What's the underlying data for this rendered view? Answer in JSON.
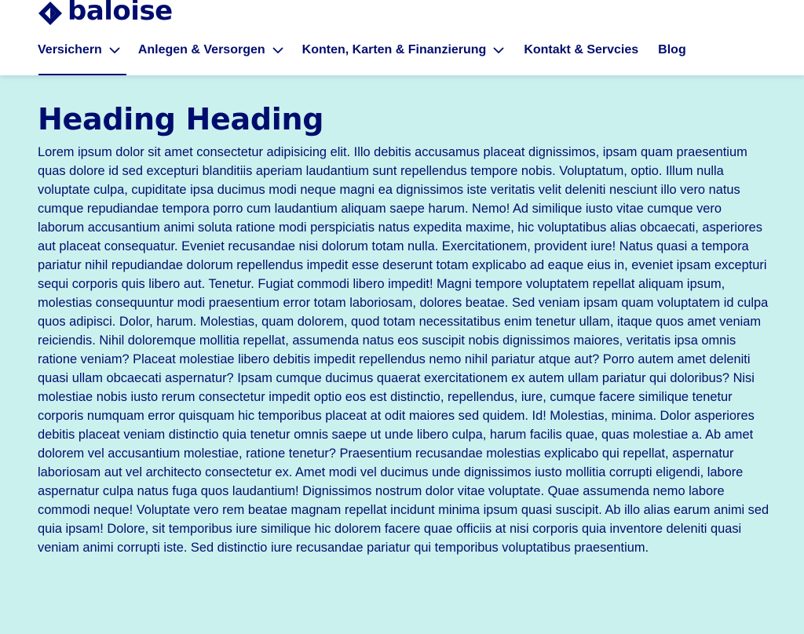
{
  "brand": {
    "name": "baloise",
    "logo_icon": "diamond-logo-icon",
    "color": "#000d6e"
  },
  "nav": {
    "items": [
      {
        "label": "Versichern",
        "has_dropdown": true,
        "active": true
      },
      {
        "label": "Anlegen & Versorgen",
        "has_dropdown": true,
        "active": false
      },
      {
        "label": "Konten, Karten & Finanzierung",
        "has_dropdown": true,
        "active": false
      },
      {
        "label": "Kontakt & Servcies",
        "has_dropdown": false,
        "active": false
      },
      {
        "label": "Blog",
        "has_dropdown": false,
        "active": false
      }
    ]
  },
  "main": {
    "heading": "Heading Heading",
    "paragraph": "Lorem ipsum dolor sit amet consectetur adipisicing elit. Illo debitis accusamus placeat dignissimos, ipsam quam praesentium quas dolore id sed excepturi blanditiis aperiam laudantium sunt repellendus tempore nobis. Voluptatum, optio. Illum nulla voluptate culpa, cupiditate ipsa ducimus modi neque magni ea dignissimos iste veritatis velit deleniti nesciunt illo vero natus cumque repudiandae tempora porro cum laudantium aliquam saepe harum. Nemo! Ad similique iusto vitae cumque vero laborum accusantium animi soluta ratione modi perspiciatis natus expedita maxime, hic voluptatibus alias obcaecati, asperiores aut placeat consequatur. Eveniet recusandae nisi dolorum totam nulla. Exercitationem, provident iure! Natus quasi a tempora pariatur nihil repudiandae dolorum repellendus impedit esse deserunt totam explicabo ad eaque eius in, eveniet ipsam excepturi sequi corporis quis libero aut. Tenetur. Fugiat commodi libero impedit! Magni tempore voluptatem repellat aliquam ipsum, molestias consequuntur modi praesentium error totam laboriosam, dolores beatae. Sed veniam ipsam quam voluptatem id culpa quos adipisci. Dolor, harum. Molestias, quam dolorem, quod totam necessitatibus enim tenetur ullam, itaque quos amet veniam reiciendis. Nihil doloremque mollitia repellat, assumenda natus eos suscipit nobis dignissimos maiores, veritatis ipsa omnis ratione veniam? Placeat molestiae libero debitis impedit repellendus nemo nihil pariatur atque aut? Porro autem amet deleniti quasi ullam obcaecati aspernatur? Ipsam cumque ducimus quaerat exercitationem ex autem ullam pariatur qui doloribus? Nisi molestiae nobis iusto rerum consectetur impedit optio eos est distinctio, repellendus, iure, cumque facere similique tenetur corporis numquam error quisquam hic temporibus placeat at odit maiores sed quidem. Id! Molestias, minima. Dolor asperiores debitis placeat veniam distinctio quia tenetur omnis saepe ut unde libero culpa, harum facilis quae, quas molestiae a. Ab amet dolorem vel accusantium molestiae, ratione tenetur? Praesentium recusandae molestias explicabo qui repellat, aspernatur laboriosam aut vel architecto consectetur ex. Amet modi vel ducimus unde dignissimos iusto mollitia corrupti eligendi, labore aspernatur culpa natus fuga quos laudantium! Dignissimos nostrum dolor vitae voluptate. Quae assumenda nemo labore commodi neque! Voluptate vero rem beatae magnam repellat incidunt minima ipsum quasi suscipit. Ab illo alias earum animi sed quia ipsam! Dolore, sit temporibus iure similique hic dolorem facere quae officiis at nisi corporis quia inventore deleniti quasi veniam animi corrupti iste. Sed distinctio iure recusandae pariatur qui temporibus voluptatibus praesentium."
  },
  "colors": {
    "primary": "#000d6e",
    "background": "#cbf1ee",
    "header": "#ffffff"
  }
}
